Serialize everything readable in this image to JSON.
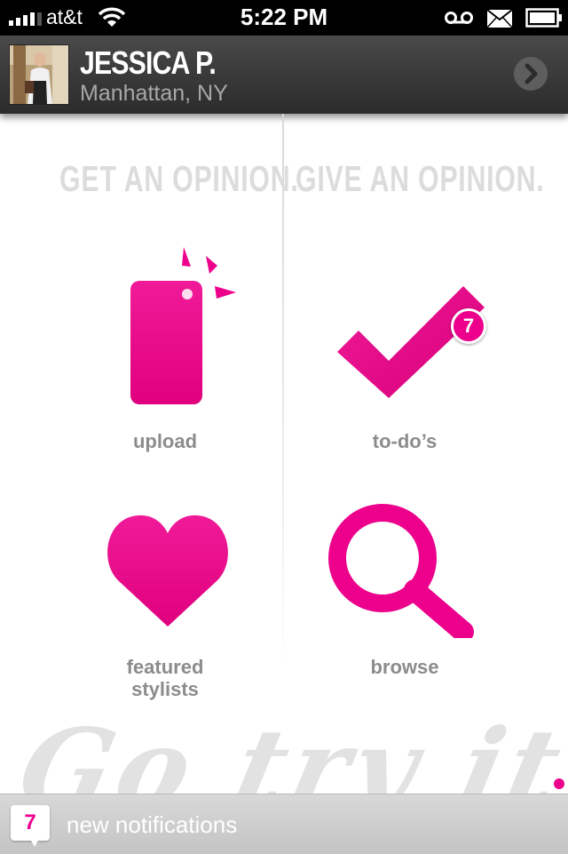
{
  "status_bar": {
    "carrier": "at&t",
    "time": "5:22 PM",
    "icons": [
      "signal-icon",
      "wifi-icon",
      "voicemail-icon",
      "mail-icon",
      "battery-icon"
    ]
  },
  "profile": {
    "name": "JESSICA P.",
    "location": "Manhattan, NY"
  },
  "sections": {
    "get_heading": "GET AN OPINION.",
    "give_heading": "GIVE AN OPINION."
  },
  "tiles": {
    "upload": {
      "label": "upload",
      "icon": "phone-camera-icon"
    },
    "todos": {
      "label": "to-do’s",
      "icon": "checkmark-icon",
      "badge": "7"
    },
    "featured": {
      "label_line1": "featured",
      "label_line2": "stylists",
      "icon": "heart-icon"
    },
    "browse": {
      "label": "browse",
      "icon": "magnifier-icon"
    }
  },
  "banner": {
    "text": "Go try it on."
  },
  "notifications": {
    "count": "7",
    "label": "new notifications"
  },
  "colors": {
    "accent": "#ec008c",
    "label_gray": "#8c8c8c",
    "heading_gray": "#dcdcdc",
    "header_dark": "#3a3a3a"
  }
}
